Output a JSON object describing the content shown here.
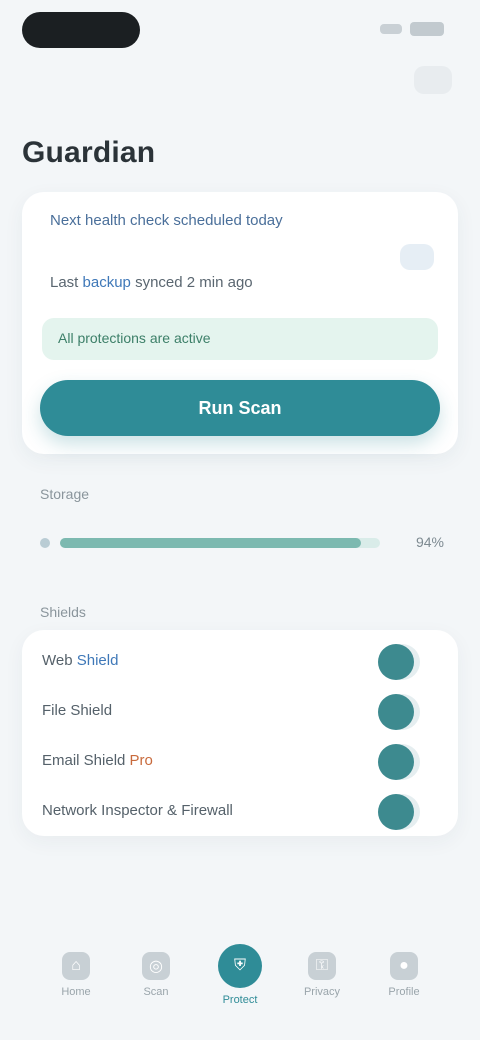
{
  "status_bar": {
    "icons": [
      "signal-icon",
      "battery-icon"
    ]
  },
  "header": {
    "title": "Guardian",
    "action_icon": "more-icon"
  },
  "card": {
    "line": "Next health check scheduled today",
    "sub_prefix": "Last ",
    "sub_accent": "backup",
    "sub_suffix": " synced 2 min ago",
    "banner": "All protections are active",
    "primary_button": "Run Scan"
  },
  "progress": {
    "label": "Storage",
    "fraction": 0.94,
    "value": "94%"
  },
  "list": {
    "label": "Shields",
    "rows": [
      {
        "prefix": "Web ",
        "accent": "Shield",
        "suffix": "",
        "accent_color": "blue",
        "enabled": true
      },
      {
        "prefix": "File Shield",
        "accent": "",
        "suffix": "",
        "accent_color": "",
        "enabled": true
      },
      {
        "prefix": "Email Shield ",
        "accent": "Pro",
        "suffix": "",
        "accent_color": "orange",
        "enabled": true
      },
      {
        "prefix": "Network Inspector & Firewall",
        "accent": "",
        "suffix": "",
        "accent_color": "",
        "enabled": true
      }
    ]
  },
  "tabs": [
    {
      "label": "Home",
      "icon": "home-icon",
      "active": false
    },
    {
      "label": "Scan",
      "icon": "scan-icon",
      "active": false
    },
    {
      "label": "Protect",
      "icon": "shield-icon",
      "active": true
    },
    {
      "label": "Privacy",
      "icon": "lock-icon",
      "active": false
    },
    {
      "label": "Profile",
      "icon": "user-icon",
      "active": false
    }
  ],
  "colors": {
    "accent": "#2f8c97",
    "banner_bg": "#e4f4ee",
    "toggle_on": "#3d8a8f"
  }
}
